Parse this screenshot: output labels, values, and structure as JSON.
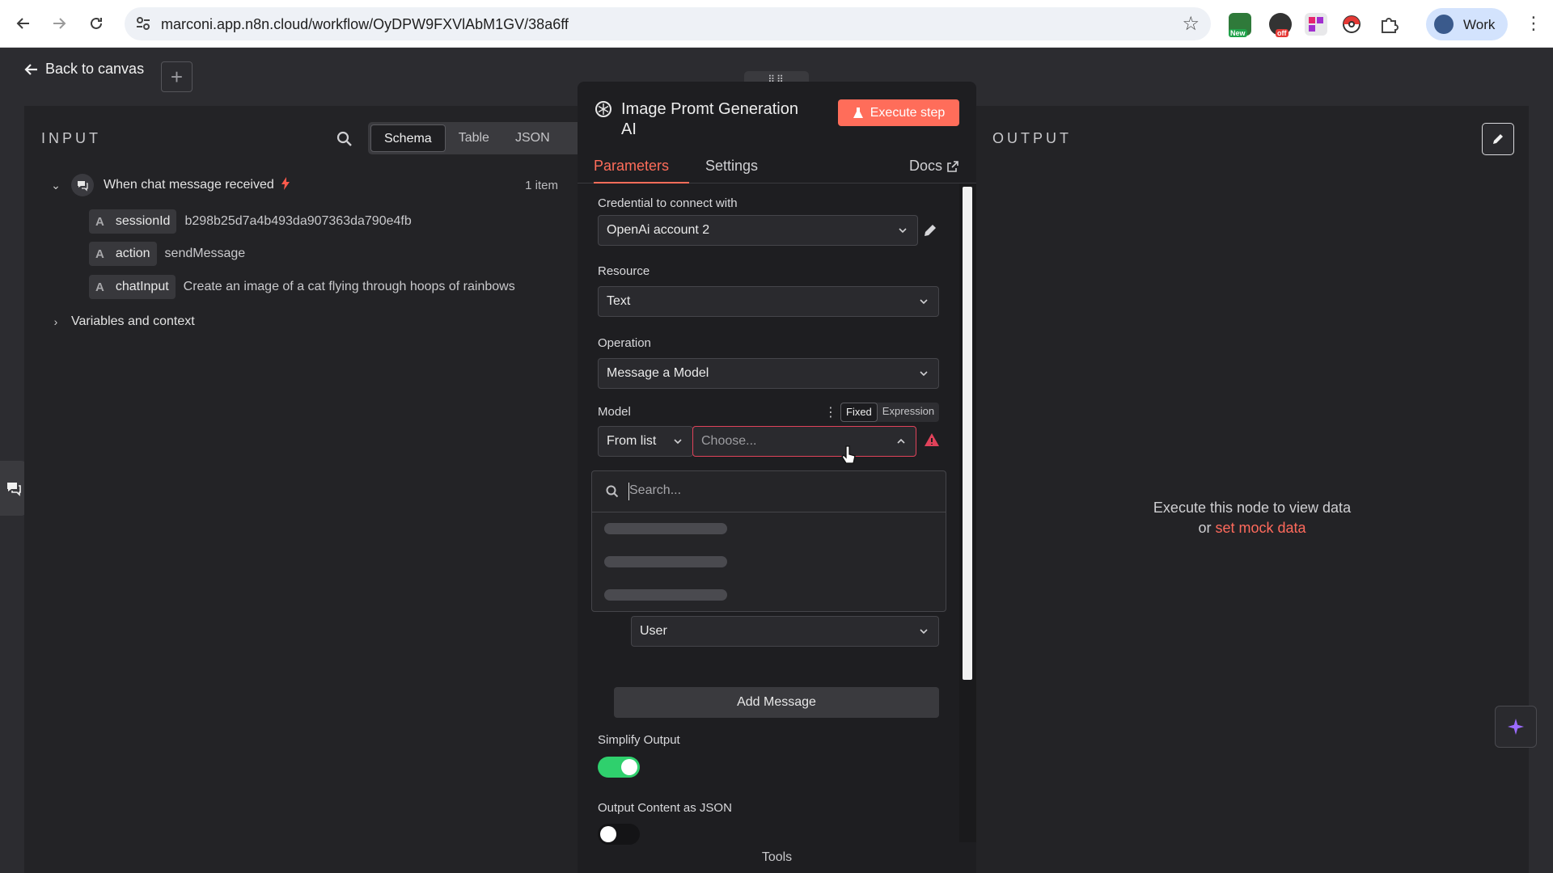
{
  "browser": {
    "url": "marconi.app.n8n.cloud/workflow/OyDPW9FXVlAbM1GV/38a6ff",
    "profile_label": "Work",
    "ext_badge_1": "New",
    "ext_badge_2": "off"
  },
  "canvas": {
    "back_label": "Back to canvas"
  },
  "input": {
    "title": "INPUT",
    "view_tabs": [
      "Schema",
      "Table",
      "JSON"
    ],
    "active_view": "Schema",
    "trigger_label": "When chat message received",
    "item_count": "1 item",
    "fields": [
      {
        "type": "A",
        "key": "sessionId",
        "value": "b298b25d7a4b493da907363da790e4fb"
      },
      {
        "type": "A",
        "key": "action",
        "value": "sendMessage"
      },
      {
        "type": "A",
        "key": "chatInput",
        "value": "Create an image of a cat flying through hoops of rainbows"
      }
    ],
    "variables_label": "Variables and context"
  },
  "node": {
    "title": "Image Promt Generation AI",
    "execute_label": "Execute step",
    "tabs": {
      "parameters": "Parameters",
      "settings": "Settings",
      "docs": "Docs"
    },
    "credential_label": "Credential to connect with",
    "credential_value": "OpenAi account 2",
    "resource_label": "Resource",
    "resource_value": "Text",
    "operation_label": "Operation",
    "operation_value": "Message a Model",
    "model_label": "Model",
    "mode_fixed": "Fixed",
    "mode_expression": "Expression",
    "model_source": "From list",
    "model_placeholder": "Choose...",
    "dropdown_search_placeholder": "Search...",
    "role_value": "User",
    "add_message_label": "Add Message",
    "simplify_label": "Simplify Output",
    "simplify_on": true,
    "json_label": "Output Content as JSON",
    "json_on": false,
    "tools_label": "Tools"
  },
  "output": {
    "title": "OUTPUT",
    "empty_line1": "Execute this node to view data",
    "empty_or": "or",
    "empty_link": "set mock data"
  },
  "colors": {
    "accent": "#ff6d5a",
    "toggle_on": "#2fd06d",
    "error": "#e0425a"
  }
}
